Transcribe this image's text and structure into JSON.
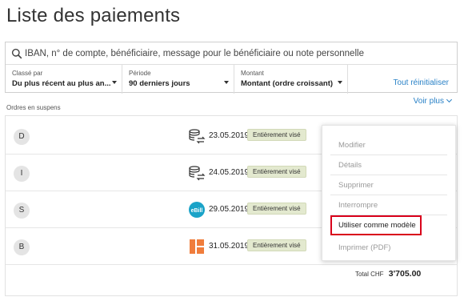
{
  "page": {
    "title": "Liste des paiements"
  },
  "search": {
    "placeholder": "IBAN, n° de compte, bénéficiaire, message pour le bénéficiaire ou note personnelle"
  },
  "filters": {
    "sort": {
      "label": "Classé par",
      "value": "Du plus récent au plus an..."
    },
    "period": {
      "label": "Période",
      "value": "90 derniers jours"
    },
    "amount": {
      "label": "Montant",
      "value": "Montant (ordre croissant)"
    },
    "reset_label": "Tout réinitialiser"
  },
  "see_more_label": "Voir plus",
  "section_label": "Ordres en suspens",
  "payments": [
    {
      "initial": "D",
      "icon": "standing-order-icon",
      "date": "23.05.2019",
      "status": "Entièrement visé"
    },
    {
      "initial": "I",
      "icon": "standing-order-icon",
      "date": "24.05.2019",
      "status": "Entièrement visé"
    },
    {
      "initial": "S",
      "icon": "ebill-icon",
      "icon_text": "eBill",
      "date": "29.05.2019",
      "status": "Entièrement visé"
    },
    {
      "initial": "B",
      "icon": "qr-bill-icon",
      "date": "31.05.2019",
      "status": "Entièrement visé"
    }
  ],
  "context_menu": {
    "items": [
      "Modifier",
      "Détails",
      "Supprimer",
      "Interrompre",
      "Utiliser comme modèle",
      "Imprimer (PDF)"
    ],
    "highlighted": "Utiliser comme modèle"
  },
  "total": {
    "label": "Total CHF",
    "amount": "3'705.00"
  },
  "colors": {
    "accent": "#2a82c7",
    "badge": "#e3e9cf",
    "highlight_border": "#d9001b",
    "ebill": "#1aa3c8",
    "qr_bill": "#f07d3c"
  }
}
